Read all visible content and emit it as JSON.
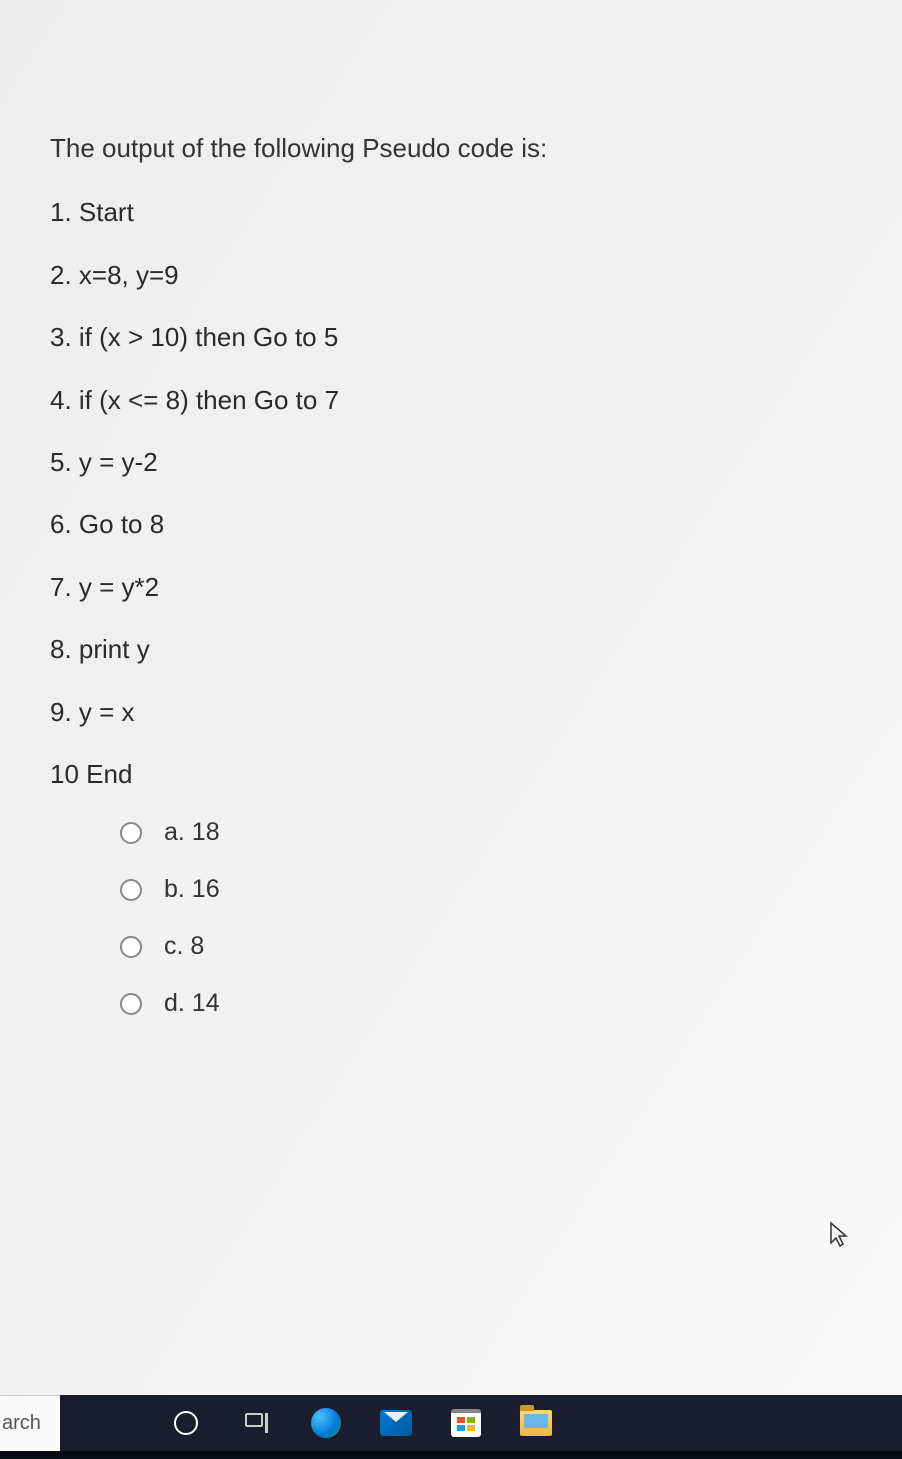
{
  "question": {
    "prompt": "The output of the following Pseudo code is:",
    "code_lines": [
      "1. Start",
      "2. x=8, y=9",
      "3. if (x > 10) then Go to 5",
      "4. if (x <= 8) then Go to 7",
      "5. y = y-2",
      "6. Go to 8",
      "7. y = y*2",
      "8. print y",
      "9. y = x",
      "10 End"
    ],
    "options": [
      {
        "label": "a. 18"
      },
      {
        "label": "b. 16"
      },
      {
        "label": "c. 8"
      },
      {
        "label": "d. 14"
      }
    ]
  },
  "taskbar": {
    "search_text": "arch"
  }
}
